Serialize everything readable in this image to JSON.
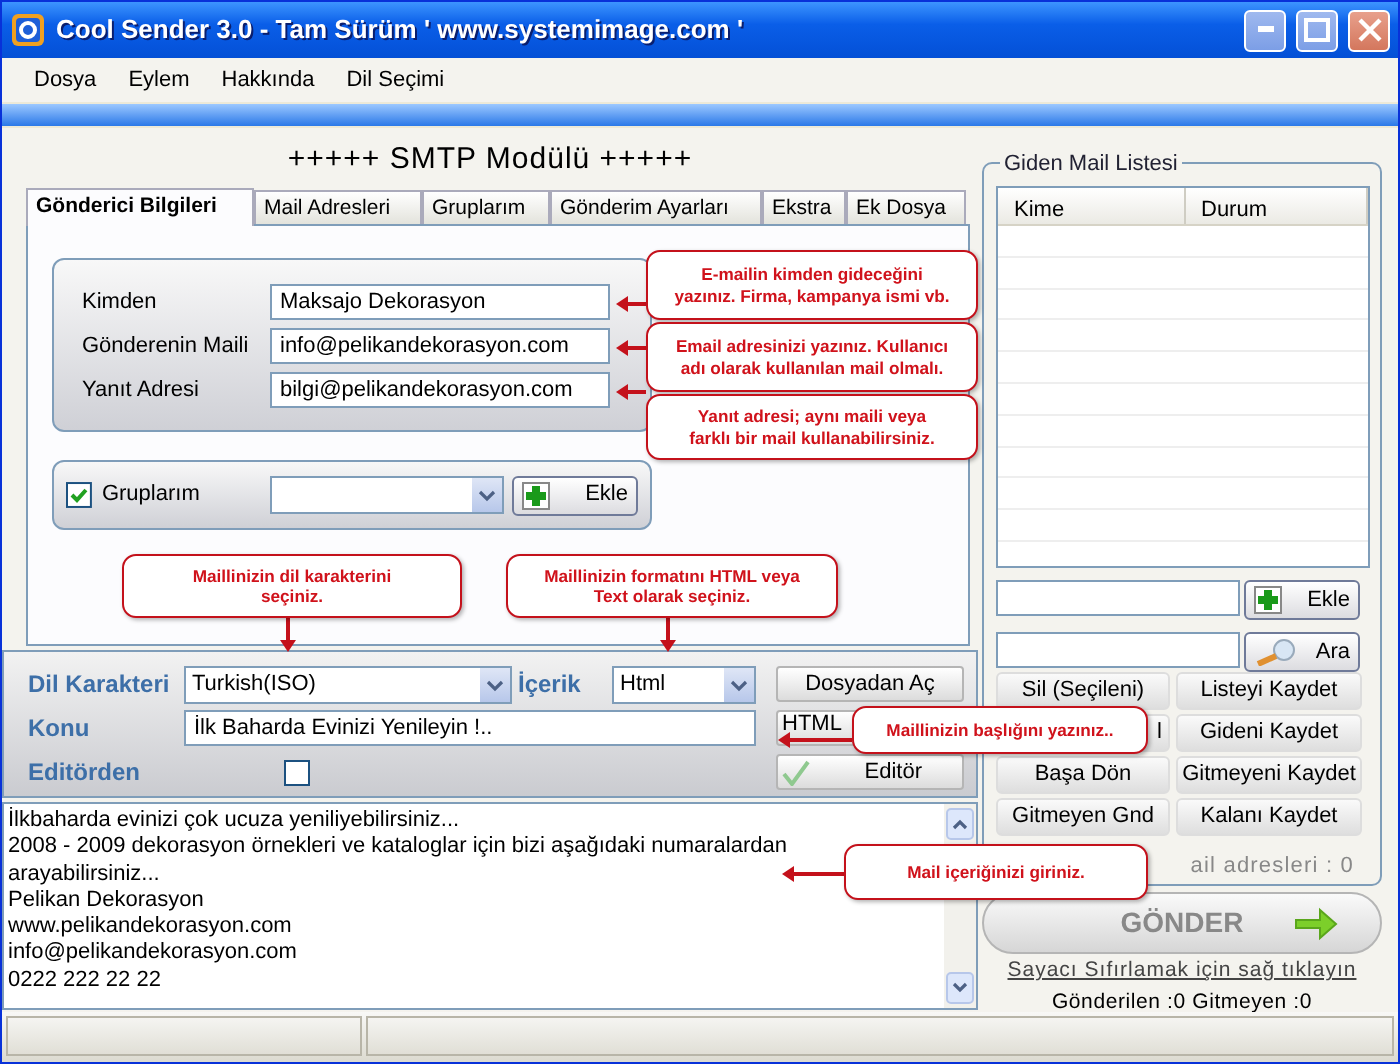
{
  "window": {
    "title": "Cool Sender 3.0 - Tam Sürüm ' www.systemimage.com '"
  },
  "menu": [
    "Dosya",
    "Eylem",
    "Hakkında",
    "Dil Seçimi"
  ],
  "heading": "+++++ SMTP Modülü +++++",
  "tabs": [
    {
      "label": "Gönderici Bilgileri",
      "selected": true
    },
    {
      "label": "Mail Adresleri",
      "selected": false
    },
    {
      "label": "Gruplarım",
      "selected": false
    },
    {
      "label": "Gönderim Ayarları",
      "selected": false
    },
    {
      "label": "Ekstra",
      "selected": false
    },
    {
      "label": "Ek Dosya",
      "selected": false
    }
  ],
  "sender_fields": [
    {
      "label": "Kimden",
      "value": "Maksajo Dekorasyon"
    },
    {
      "label": "Gönderenin Maili",
      "value": "info@pelikandekorasyon.com"
    },
    {
      "label": "Yanıt Adresi",
      "value": "bilgi@pelikandekorasyon.com"
    }
  ],
  "groups": {
    "label": "Gruplarım",
    "checked": true,
    "button": "Ekle"
  },
  "message_settings": {
    "charset_label": "Dil Karakteri",
    "charset": "Turkish(ISO)",
    "content_label": "İçerik",
    "content": "Html",
    "subject_label": "Konu",
    "subject": "İlk Baharda Evinizi Yenileyin !..",
    "editor_label": "Editörden",
    "editor_checked": false,
    "buttons": [
      "Dosyadan Aç",
      "HTML",
      "Editör"
    ]
  },
  "message_lines": [
    "İlkbaharda evinizi çok ucuza yeniliyebilirsiniz...",
    "2008 - 2009 dekorasyon örnekleri ve kataloglar için bizi aşağıdaki numaralardan",
    "arayabilirsiniz...",
    "Pelikan Dekorasyon",
    "www.pelikandekorasyon.com",
    "info@pelikandekorasyon.com",
    "0222 222 22 22"
  ],
  "outbox": {
    "title": "Giden Mail Listesi",
    "columns": [
      "Kime",
      "Durum"
    ],
    "add_button": "Ekle",
    "search_button": "Ara",
    "buttons": [
      "Sil (Seçileni)",
      "Listeyi Kaydet",
      "l",
      "Gideni Kaydet",
      "Başa Dön",
      "Gitmeyeni Kaydet",
      "Gitmeyen Gnd",
      "Kalanı Kaydet"
    ],
    "counter": "ail adresleri : 0",
    "send_button": "GÖNDER",
    "reset_link": "Sayacı Sıfırlamak için sağ tıklayın",
    "stats": "Gönderilen :0 Gitmeyen :0"
  },
  "callouts": [
    {
      "lines": [
        "E-mailin kimden gideceğini",
        "yazınız. Firma, kampanya ismi vb."
      ]
    },
    {
      "lines": [
        "Email adresinizi yazınız. Kullanıcı",
        "adı olarak kullanılan mail olmalı."
      ]
    },
    {
      "lines": [
        "Yanıt adresi; aynı maili veya",
        "farklı bir mail kullanabilirsiniz."
      ]
    },
    {
      "lines": [
        "Maillinizin dil karakterini",
        "seçiniz."
      ]
    },
    {
      "lines": [
        "Maillinizin formatını HTML veya",
        "Text olarak seçiniz."
      ]
    },
    {
      "lines": [
        "Maillinizin başlığını yazınız.."
      ]
    },
    {
      "lines": [
        "Mail içeriğinizi giriniz."
      ]
    }
  ]
}
